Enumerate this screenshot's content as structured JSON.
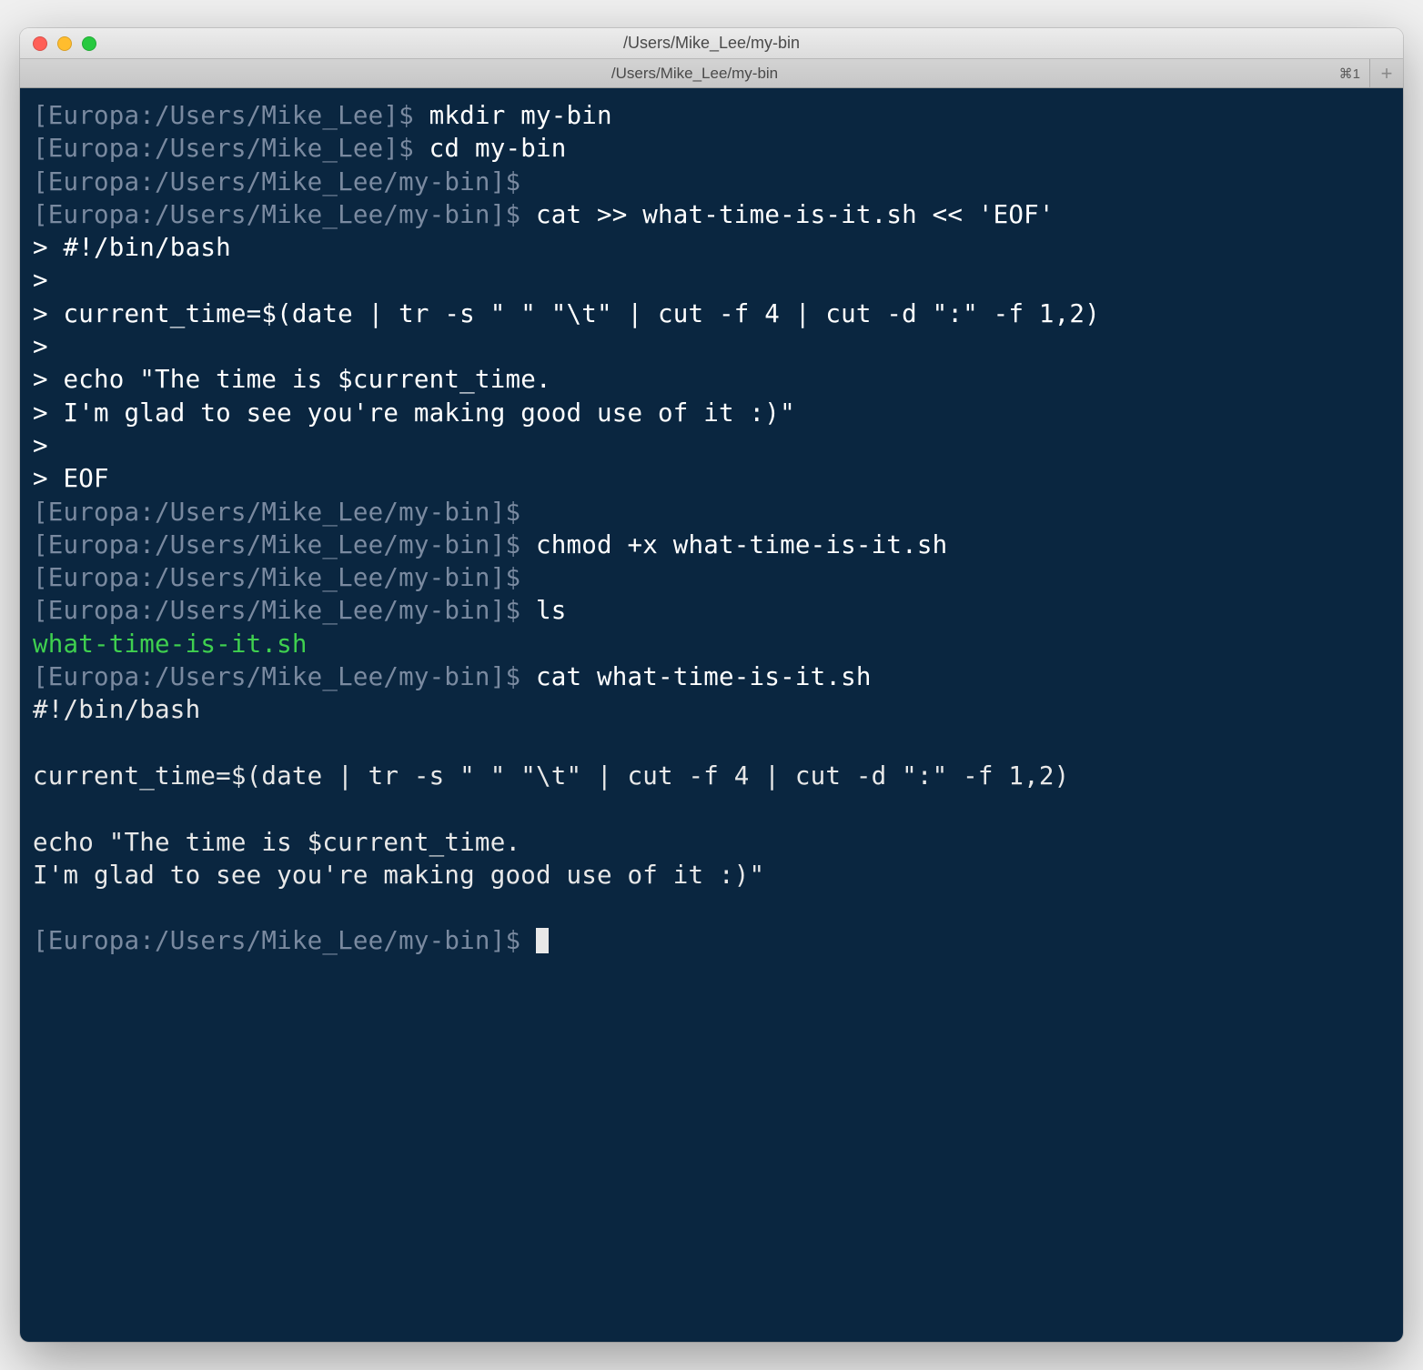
{
  "window": {
    "title": "/Users/Mike_Lee/my-bin"
  },
  "tabbar": {
    "tab_label": "/Users/Mike_Lee/my-bin",
    "tab_shortcut": "⌘1",
    "add_label": "+"
  },
  "terminal": {
    "lines": [
      {
        "prompt": "[Europa:/Users/Mike_Lee]$ ",
        "cmd": "mkdir my-bin"
      },
      {
        "prompt": "[Europa:/Users/Mike_Lee]$ ",
        "cmd": "cd my-bin"
      },
      {
        "prompt": "[Europa:/Users/Mike_Lee/my-bin]$",
        "cmd": ""
      },
      {
        "prompt": "[Europa:/Users/Mike_Lee/my-bin]$ ",
        "cmd": "cat >> what-time-is-it.sh << 'EOF'"
      },
      {
        "cont": "> ",
        "cmd": "#!/bin/bash"
      },
      {
        "cont": "> ",
        "cmd": ""
      },
      {
        "cont": "> ",
        "cmd": "current_time=$(date | tr -s \" \" \"\\t\" | cut -f 4 | cut -d \":\" -f 1,2)"
      },
      {
        "cont": "> ",
        "cmd": ""
      },
      {
        "cont": "> ",
        "cmd": "echo \"The time is $current_time."
      },
      {
        "cont": "> ",
        "cmd": "I'm glad to see you're making good use of it :)\""
      },
      {
        "cont": "> ",
        "cmd": ""
      },
      {
        "cont": "> ",
        "cmd": "EOF"
      },
      {
        "prompt": "[Europa:/Users/Mike_Lee/my-bin]$",
        "cmd": ""
      },
      {
        "prompt": "[Europa:/Users/Mike_Lee/my-bin]$ ",
        "cmd": "chmod +x what-time-is-it.sh"
      },
      {
        "prompt": "[Europa:/Users/Mike_Lee/my-bin]$",
        "cmd": ""
      },
      {
        "prompt": "[Europa:/Users/Mike_Lee/my-bin]$ ",
        "cmd": "ls"
      },
      {
        "exec": "what-time-is-it.sh"
      },
      {
        "prompt": "[Europa:/Users/Mike_Lee/my-bin]$ ",
        "cmd": "cat what-time-is-it.sh"
      },
      {
        "out": "#!/bin/bash"
      },
      {
        "out": ""
      },
      {
        "out": "current_time=$(date | tr -s \" \" \"\\t\" | cut -f 4 | cut -d \":\" -f 1,2)"
      },
      {
        "out": ""
      },
      {
        "out": "echo \"The time is $current_time."
      },
      {
        "out": "I'm glad to see you're making good use of it :)\""
      },
      {
        "out": ""
      },
      {
        "prompt": "[Europa:/Users/Mike_Lee/my-bin]$ ",
        "cursor": true
      }
    ]
  }
}
